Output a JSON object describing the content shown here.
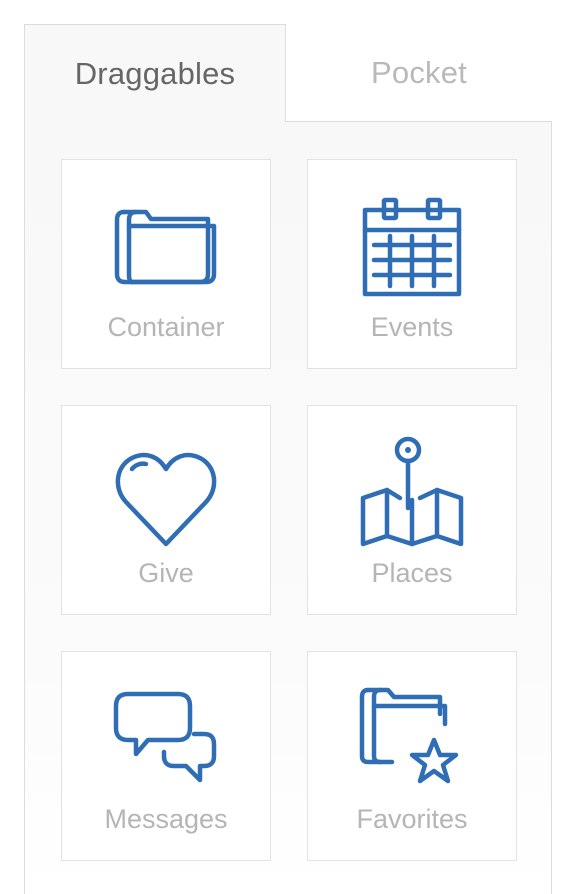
{
  "tabs": [
    {
      "label": "Draggables",
      "active": true
    },
    {
      "label": "Pocket",
      "active": false
    }
  ],
  "tiles": [
    {
      "label": "Container",
      "icon": "folder-icon"
    },
    {
      "label": "Events",
      "icon": "calendar-icon"
    },
    {
      "label": "Give",
      "icon": "heart-icon"
    },
    {
      "label": "Places",
      "icon": "map-pin-icon"
    },
    {
      "label": "Messages",
      "icon": "chat-bubbles-icon"
    },
    {
      "label": "Favorites",
      "icon": "folder-star-icon"
    }
  ],
  "colors": {
    "icon_stroke": "#2f6db5",
    "label_text": "#b5b5b5",
    "active_tab_text": "#666666",
    "inactive_tab_text": "#b9b9b9",
    "panel_background": "#f8f8f8",
    "tile_border": "#e2e2e2"
  }
}
